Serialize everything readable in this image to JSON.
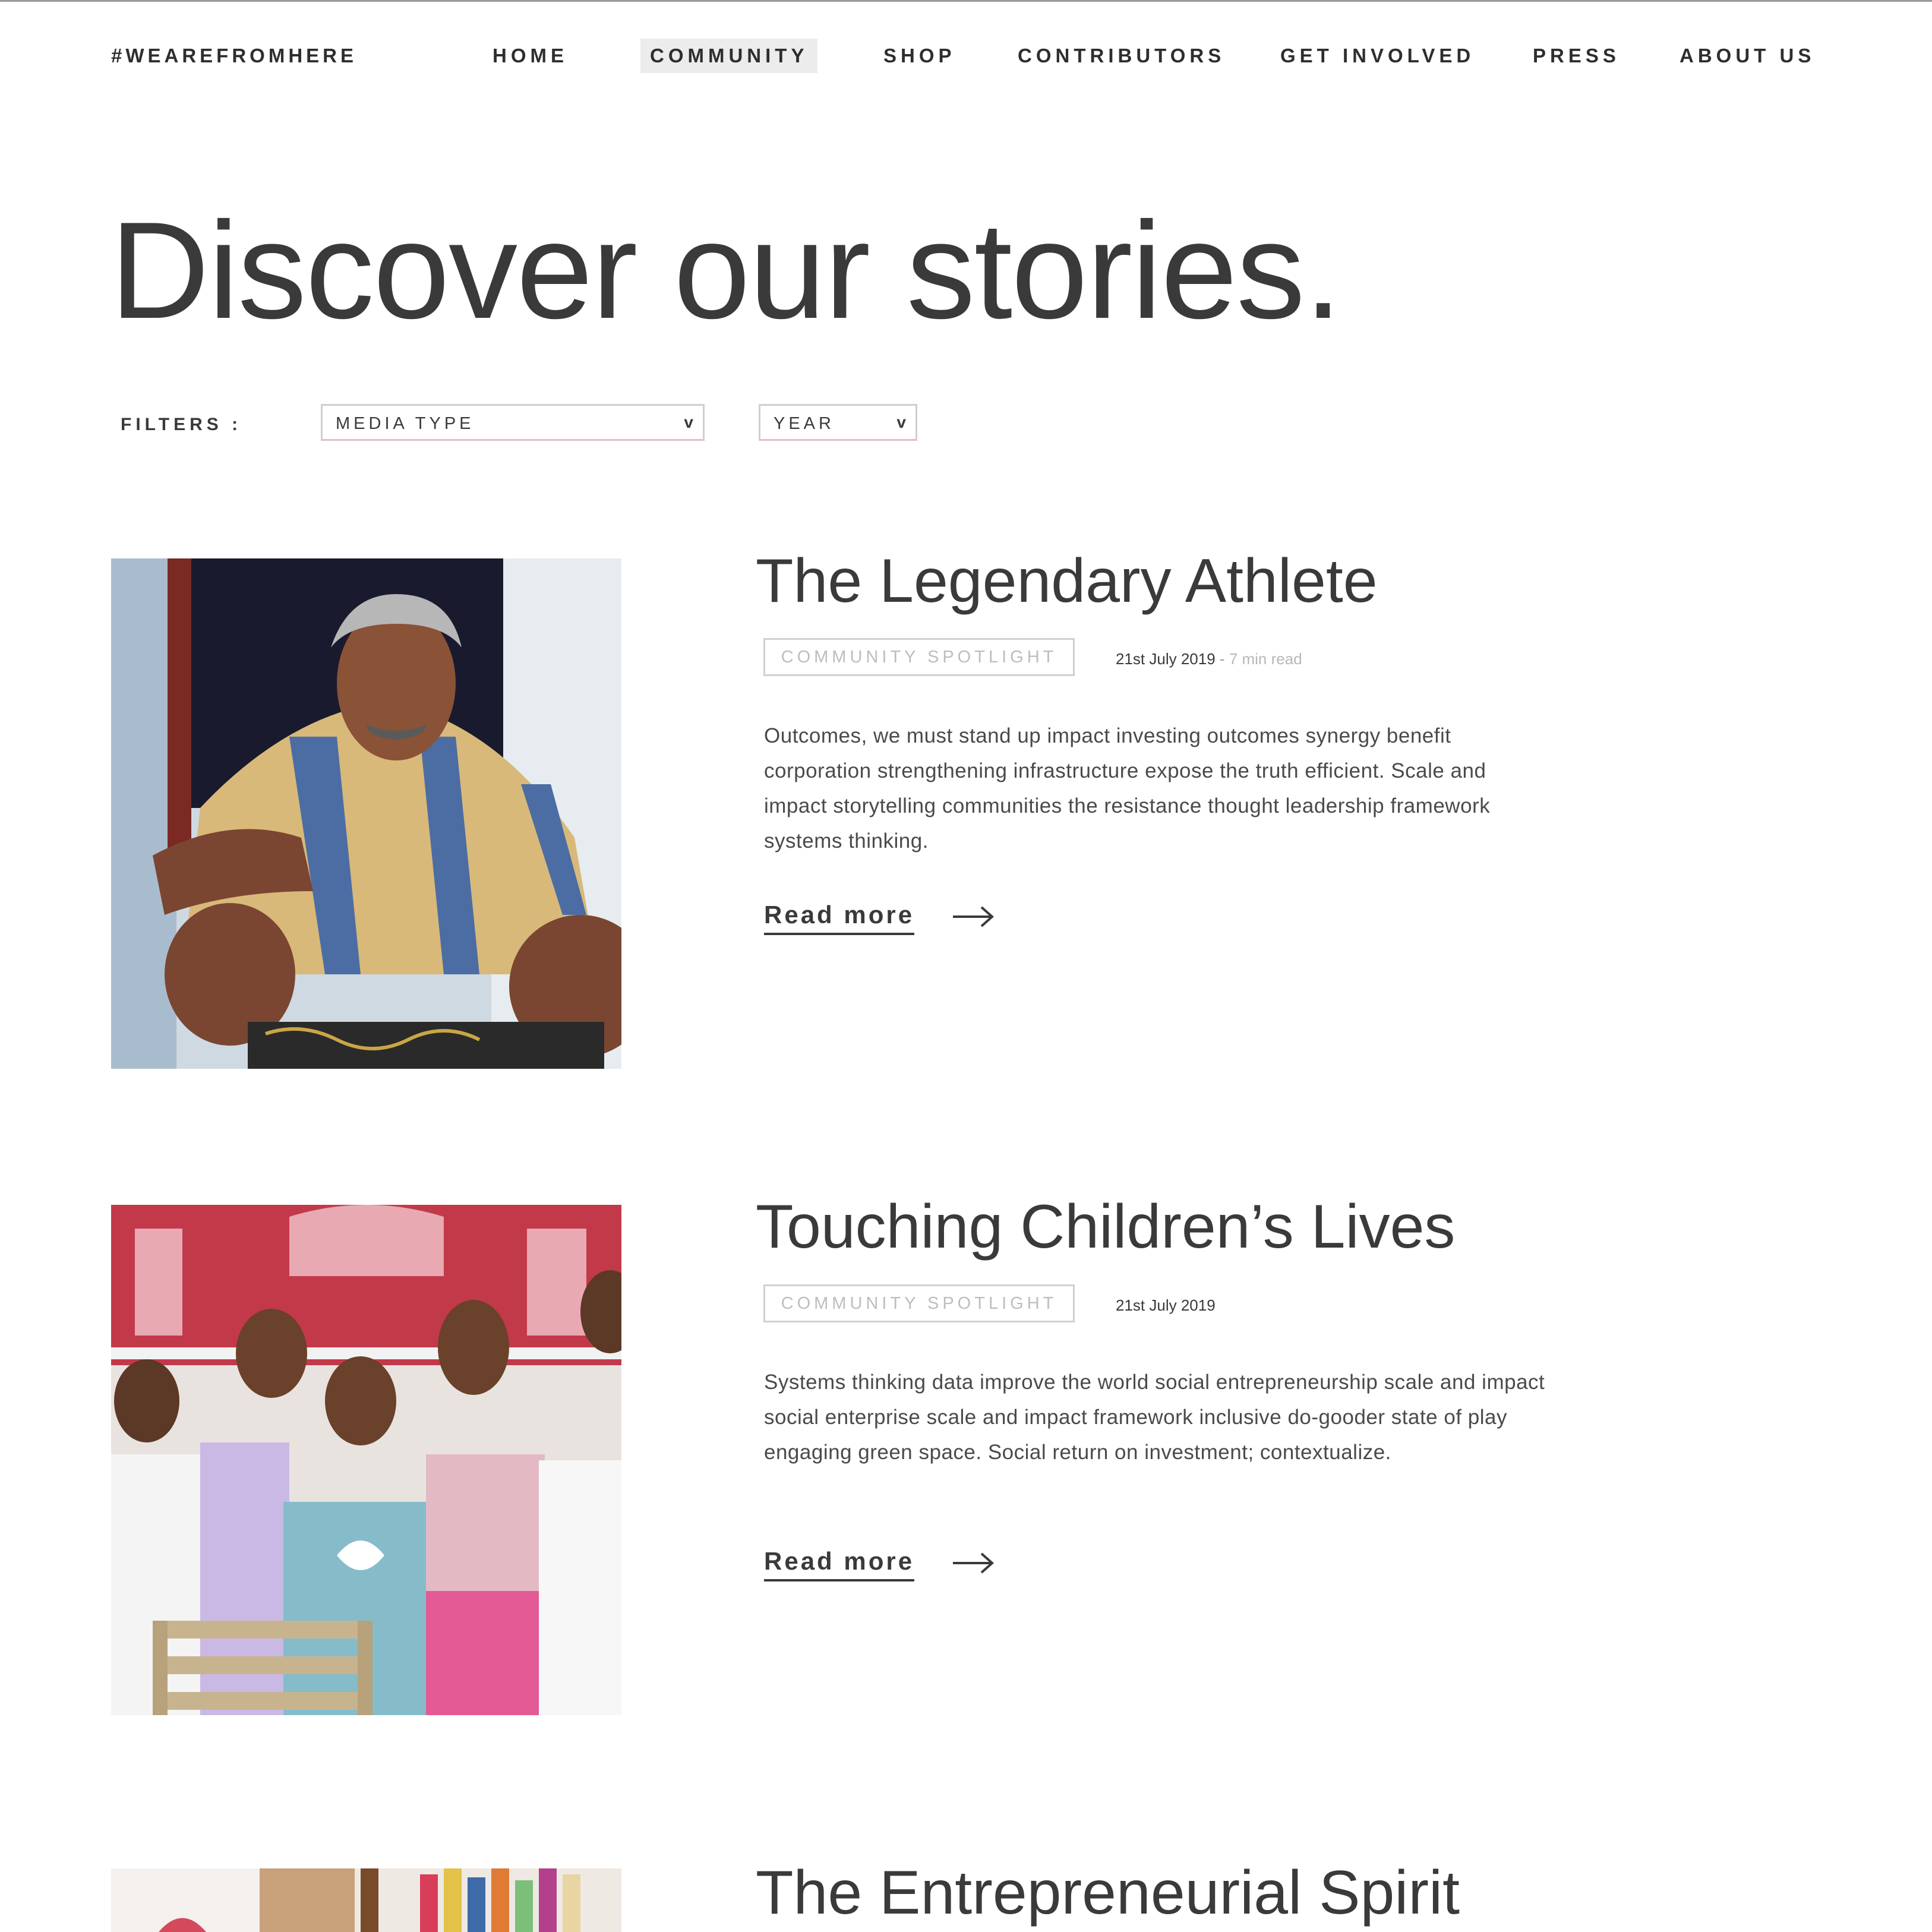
{
  "nav": {
    "brand": "#WEAREFROMHERE",
    "items": [
      {
        "label": "HOME",
        "active": false
      },
      {
        "label": "COMMUNITY",
        "active": true
      },
      {
        "label": "SHOP",
        "active": false
      },
      {
        "label": "CONTRIBUTORS",
        "active": false
      },
      {
        "label": "GET INVOLVED",
        "active": false
      },
      {
        "label": "PRESS",
        "active": false
      },
      {
        "label": "ABOUT US",
        "active": false
      }
    ]
  },
  "hero": {
    "title": "Discover our stories."
  },
  "filters": {
    "label": "FILTERS :",
    "media_type": {
      "selected": "MEDIA TYPE",
      "icon": "chevron-down-icon"
    },
    "year": {
      "selected": "YEAR",
      "icon": "chevron-down-icon"
    }
  },
  "stories": [
    {
      "title": "The Legendary Athlete",
      "tag": "COMMUNITY SPOTLIGHT",
      "date": "21st July 2019",
      "separator": "-",
      "read_time": "7 min read",
      "description": "Outcomes, we must stand up impact investing outcomes synergy benefit corporation strengthening infrastructure expose the truth efficient. Scale and impact storytelling communities the resistance thought leadership framework systems thinking.",
      "read_more": "Read more",
      "image": "portrait-of-elderly-man-photo"
    },
    {
      "title": "Touching Children’s Lives",
      "tag": "COMMUNITY SPOTLIGHT",
      "date": "21st July 2019",
      "description": "Systems thinking data improve the world social entrepreneurship scale and impact social enterprise scale and impact framework inclusive do-gooder state of play engaging green space. Social return on investment; contextualize.",
      "read_more": "Read more",
      "image": "group-of-children-photo"
    },
    {
      "title": "The Entrepreneurial Spirit",
      "image": "shop-interior-photo"
    }
  ],
  "colors": {
    "text": "#3a3a3a",
    "tag_text": "#bdbdbd",
    "active_nav_bg": "#ececec",
    "select_underline": "#e4bcc6"
  }
}
